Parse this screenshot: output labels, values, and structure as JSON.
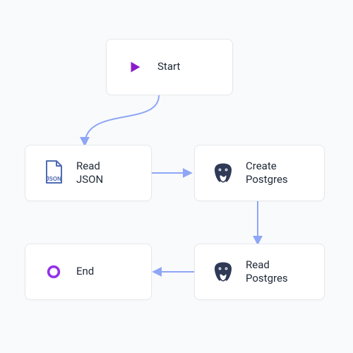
{
  "nodes": {
    "start": {
      "label": "Start"
    },
    "read_json": {
      "label": "Read JSON"
    },
    "create_pg": {
      "label": "Create Postgres"
    },
    "read_pg": {
      "label": "Read Postgres"
    },
    "end": {
      "label": "End"
    }
  },
  "colors": {
    "connector": "#8ea6f5",
    "start_icon": "#8a1cc9",
    "end_ring": "#9333ea",
    "json_text": "#4f6bb3",
    "pg_body": "#2f3a57"
  }
}
